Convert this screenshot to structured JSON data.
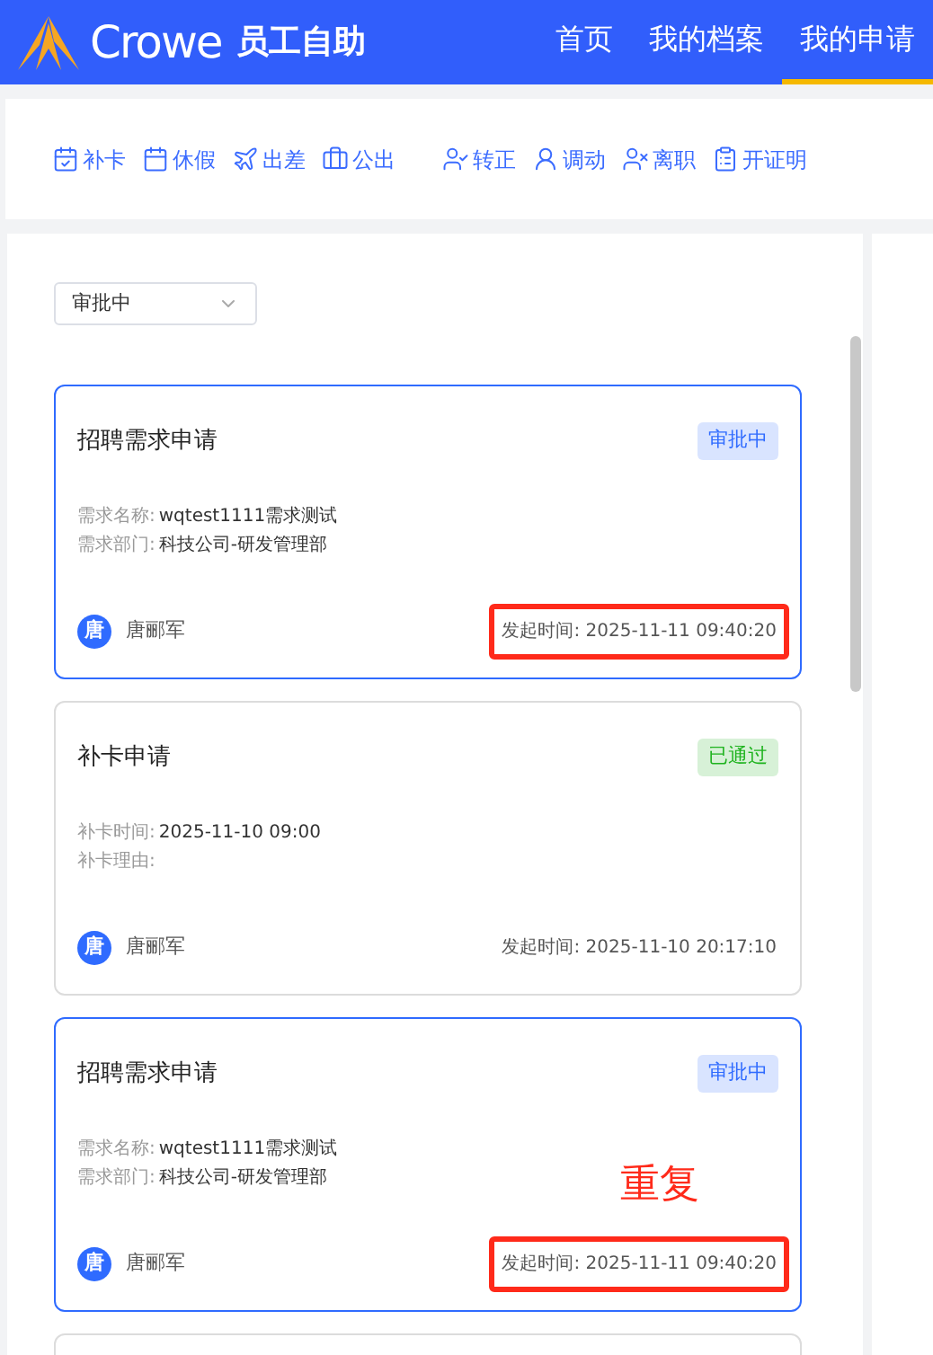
{
  "header": {
    "brand": "Crowe",
    "app_name": "员工自助",
    "nav": [
      {
        "label": "首页",
        "selected": false
      },
      {
        "label": "我的档案",
        "selected": false
      },
      {
        "label": "我的申请",
        "selected": true
      }
    ]
  },
  "toolbar": {
    "groups": [
      [
        {
          "label": "补卡",
          "kind": "calendar-check"
        },
        {
          "label": "休假",
          "kind": "calendar"
        },
        {
          "label": "出差",
          "kind": "plane"
        },
        {
          "label": "公出",
          "kind": "briefcase"
        }
      ],
      [
        {
          "label": "转正",
          "kind": "user-check"
        },
        {
          "label": "调动",
          "kind": "user-arrow"
        },
        {
          "label": "离职",
          "kind": "user-out"
        },
        {
          "label": "开证明",
          "kind": "clipboard"
        }
      ]
    ]
  },
  "filter": {
    "value": "审批中"
  },
  "cards": [
    {
      "title": "招聘需求申请",
      "status": "审批中",
      "color": "#2f6bff",
      "selected": true,
      "fields": [
        {
          "label": "需求名称:",
          "value": "wqtest1111需求测试"
        },
        {
          "label": "需求部门:",
          "value": "科技公司-研发管理部"
        }
      ],
      "avatar": "唐",
      "applicant": "唐郦军",
      "time": "发起时间: 2025-11-11 09:40:20",
      "highlighted": true
    },
    {
      "title": "补卡申请",
      "status": "已通过",
      "color": "#1fb31f",
      "selected": false,
      "fields": [
        {
          "label": "补卡时间:",
          "value": "2025-11-10 09:00"
        },
        {
          "label": "补卡理由:"
        }
      ],
      "avatar": "唐",
      "applicant": "唐郦军",
      "time": "发起时间: 2025-11-10 20:17:10",
      "highlighted": false
    },
    {
      "title": "招聘需求申请",
      "status": "审批中",
      "color": "#2f6bff",
      "selected": true,
      "fields": [
        {
          "label": "需求名称:",
          "value": "wqtest1111需求测试"
        },
        {
          "label": "需求部门:",
          "value": "科技公司-研发管理部"
        }
      ],
      "avatar": "唐",
      "applicant": "唐郦军",
      "time": "发起时间: 2025-11-11 09:40:20",
      "highlighted": true,
      "annotation": "重复"
    }
  ]
}
